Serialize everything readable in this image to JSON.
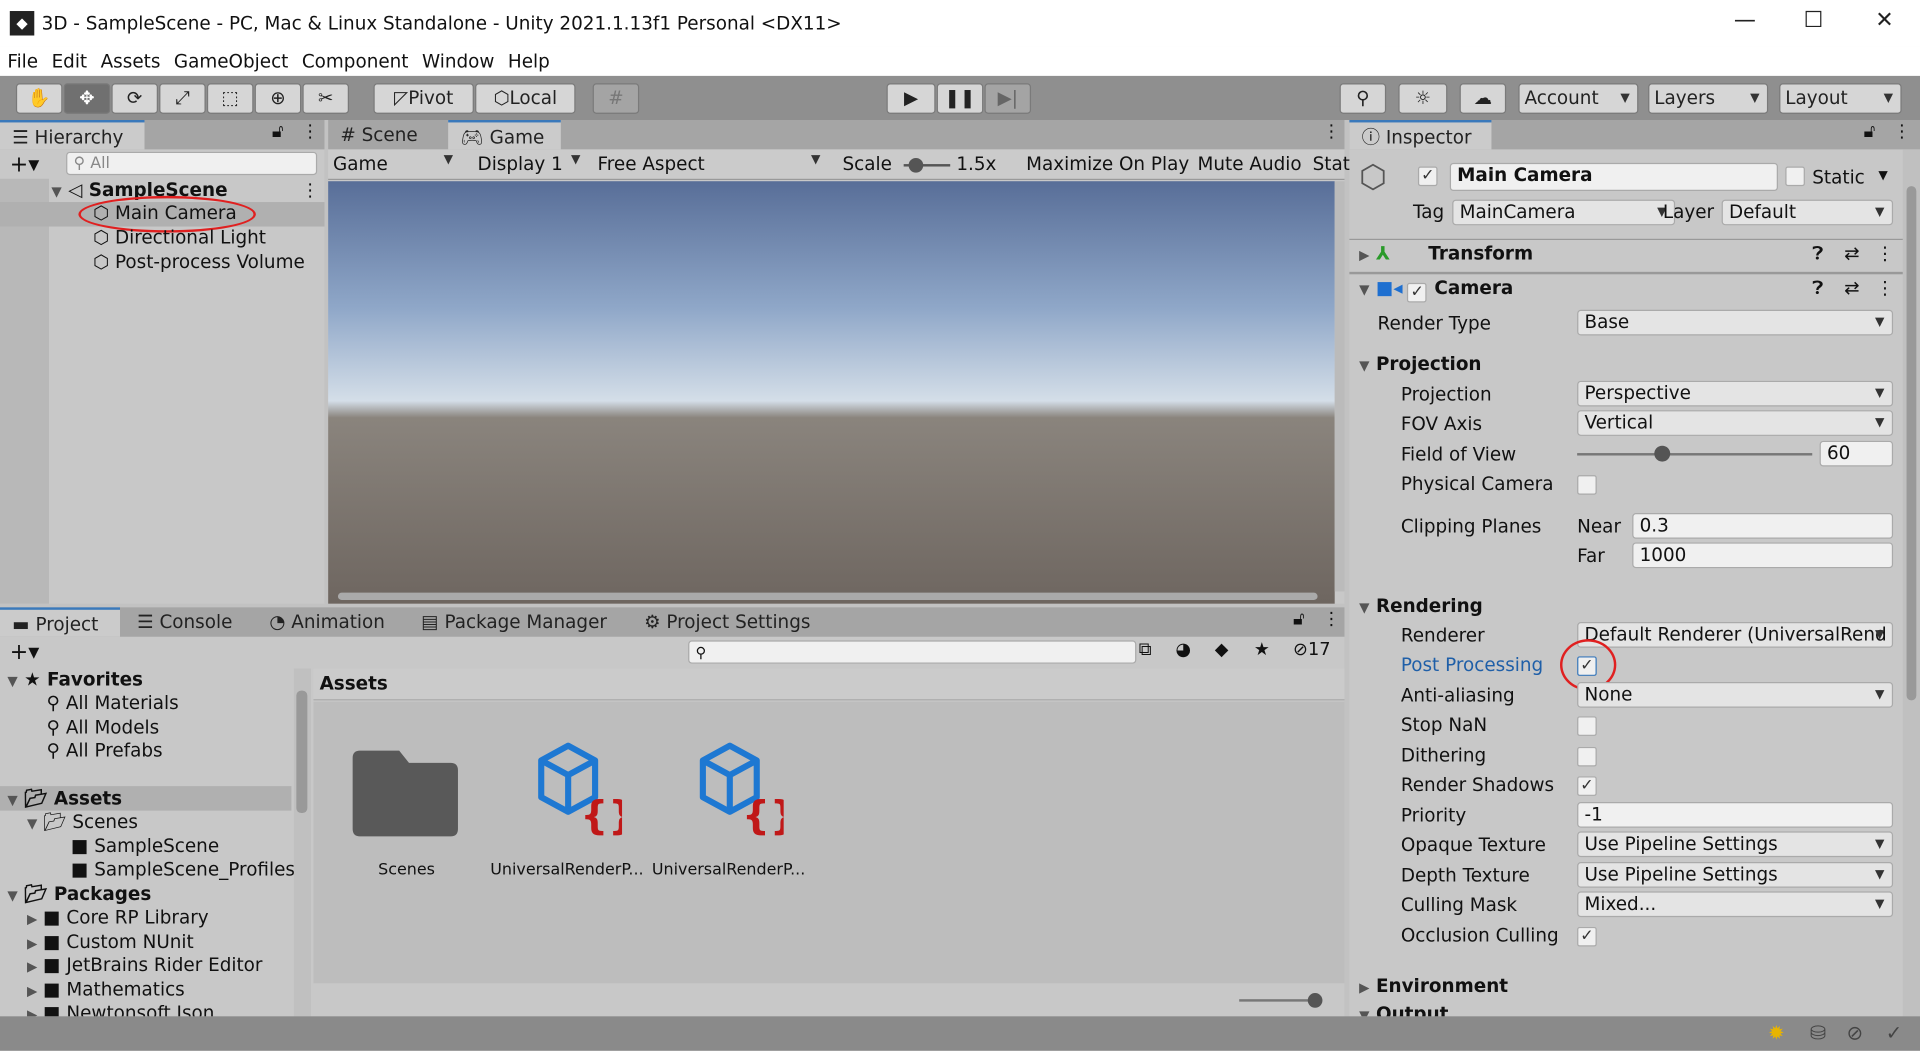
{
  "window": {
    "title": "3D - SampleScene - PC, Mac & Linux Standalone - Unity 2021.1.13f1 Personal <DX11>"
  },
  "menu": [
    "File",
    "Edit",
    "Assets",
    "GameObject",
    "Component",
    "Window",
    "Help"
  ],
  "toolbar": {
    "tools": [
      "hand-tool",
      "move-tool",
      "rotate-tool",
      "scale-tool",
      "rect-tool",
      "transform-tool",
      "custom-tool"
    ],
    "pivot": "Pivot",
    "local": "Local",
    "account": "Account",
    "layers": "Layers",
    "layout": "Layout"
  },
  "hierarchy": {
    "tab": "Hierarchy",
    "search_placeholder": "All",
    "scene": "SampleScene",
    "items": [
      "Main Camera",
      "Directional Light",
      "Post-process Volume"
    ]
  },
  "view": {
    "tabs": [
      "Scene",
      "Game"
    ],
    "game_dropdown": "Game",
    "display": "Display 1",
    "aspect": "Free Aspect",
    "scale_label": "Scale",
    "scale_value": "1.5x",
    "maximize": "Maximize On Play",
    "mute": "Mute Audio",
    "stats": "Stat"
  },
  "project": {
    "tabs": [
      "Project",
      "Console",
      "Animation",
      "Package Manager",
      "Project Settings"
    ],
    "hidden_count": "17",
    "favorites": {
      "label": "Favorites",
      "items": [
        "All Materials",
        "All Models",
        "All Prefabs"
      ]
    },
    "assets": {
      "label": "Assets",
      "scenes": "Scenes",
      "children": [
        "SampleScene",
        "SampleScene_Profiles"
      ]
    },
    "packages": {
      "label": "Packages",
      "items": [
        "Core RP Library",
        "Custom NUnit",
        "JetBrains Rider Editor",
        "Mathematics",
        "Newtonsoft Json"
      ]
    },
    "breadcrumb": "Assets",
    "grid": [
      "Scenes",
      "UniversalRenderP...",
      "UniversalRenderP..."
    ]
  },
  "inspector": {
    "tab": "Inspector",
    "name": "Main Camera",
    "static": "Static",
    "tag_label": "Tag",
    "tag": "MainCamera",
    "layer_label": "Layer",
    "layer": "Default",
    "components": [
      "Transform",
      "Camera"
    ],
    "render_type": {
      "label": "Render Type",
      "value": "Base"
    },
    "projection_header": "Projection",
    "projection": {
      "label": "Projection",
      "value": "Perspective"
    },
    "fov_axis": {
      "label": "FOV Axis",
      "value": "Vertical"
    },
    "fov": {
      "label": "Field of View",
      "value": "60",
      "fraction": 0.36
    },
    "physical": {
      "label": "Physical Camera",
      "checked": false
    },
    "clipping": {
      "label": "Clipping Planes",
      "near_label": "Near",
      "near": "0.3",
      "far_label": "Far",
      "far": "1000"
    },
    "rendering_header": "Rendering",
    "renderer": {
      "label": "Renderer",
      "value": "Default Renderer (UniversalRend"
    },
    "post": {
      "label": "Post Processing",
      "checked": true
    },
    "aa": {
      "label": "Anti-aliasing",
      "value": "None"
    },
    "stopnan": {
      "label": "Stop NaN",
      "checked": false
    },
    "dither": {
      "label": "Dithering",
      "checked": false
    },
    "shadows": {
      "label": "Render Shadows",
      "checked": true
    },
    "priority": {
      "label": "Priority",
      "value": "-1"
    },
    "opaque": {
      "label": "Opaque Texture",
      "value": "Use Pipeline Settings"
    },
    "depth": {
      "label": "Depth Texture",
      "value": "Use Pipeline Settings"
    },
    "culling": {
      "label": "Culling Mask",
      "value": "Mixed..."
    },
    "occlusion": {
      "label": "Occlusion Culling",
      "checked": true
    },
    "environment": "Environment",
    "output": "Output"
  },
  "colors": {
    "accent": "#3a79bb",
    "highlight": "#e02020",
    "post_label": "#1f5fa8"
  }
}
